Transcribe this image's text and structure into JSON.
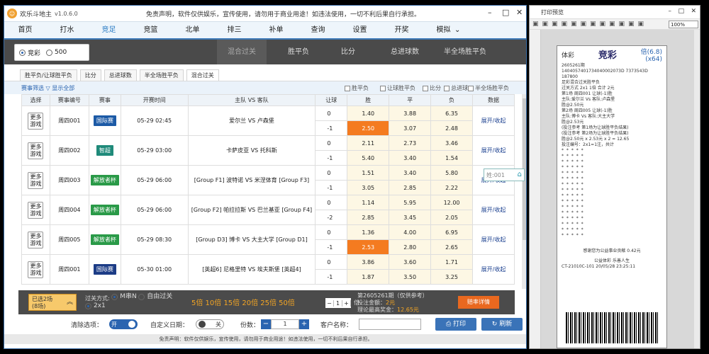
{
  "app": {
    "title": "欢乐斗地主",
    "version": "v1.0.6.0",
    "disclaimer": "免责声明，软件仅供娱乐，宣传使用，请勿用于商业用途！如违法使用，一切不利后果自行承担。"
  },
  "nav": [
    "首页",
    "打水",
    "竞足",
    "竞篮",
    "北单",
    "排三",
    "补单",
    "查询",
    "设置",
    "开奖",
    "模拟"
  ],
  "nav_active": "竞足",
  "lottery": {
    "options": [
      "竞彩",
      "500"
    ],
    "selected": "竞彩"
  },
  "play_tabs": [
    "混合过关",
    "胜平负",
    "比分",
    "总进球数",
    "半全场胜平负"
  ],
  "play_tab_active": "混合过关",
  "sub_tabs": [
    "胜平负/让球胜平负",
    "比分",
    "总进球数",
    "半全场胜平负",
    "混合过关"
  ],
  "sub_tab_active": "混合过关",
  "filter": {
    "left": "赛事筛选 ▽  显示全部",
    "checks": [
      "胜平负",
      "让球胜平负",
      "比分",
      "总进球",
      "半全场胜平负"
    ]
  },
  "table": {
    "headers": [
      "选择",
      "赛事编号",
      "赛事",
      "开赛时间",
      "主队 VS 客队",
      "让球",
      "胜",
      "平",
      "负",
      "数据"
    ],
    "more_label": "更多\n游戏",
    "expand_label": "展开/收起",
    "rows": [
      {
        "id": "周四001",
        "league": "国际赛",
        "league_color": "#1c5aa6",
        "time": "05-29 02:45",
        "teams": "爱尔兰 VS 卢森堡",
        "hcp": [
          "0",
          "-1"
        ],
        "odds": [
          [
            "1.40",
            "3.88",
            "6.35"
          ],
          [
            "2.50",
            "3.07",
            "2.48"
          ]
        ],
        "hl": [
          null,
          0
        ]
      },
      {
        "id": "周四002",
        "league": "智超",
        "league_color": "#1f8a7a",
        "time": "05-29 03:00",
        "teams": "卡萨皮亚 VS 托科斯",
        "hcp": [
          "0",
          "-1"
        ],
        "odds": [
          [
            "2.11",
            "2.73",
            "3.46"
          ],
          [
            "5.40",
            "3.40",
            "1.54"
          ]
        ],
        "hl": [
          null,
          null
        ]
      },
      {
        "id": "周四003",
        "league": "解放者杯",
        "league_color": "#2a9a48",
        "time": "05-29 06:00",
        "teams": "[Group F1] 波特诺 VS 米涅体育 [Group F3]",
        "hcp": [
          "0",
          "-1"
        ],
        "odds": [
          [
            "1.51",
            "3.40",
            "5.80"
          ],
          [
            "3.05",
            "2.85",
            "2.22"
          ]
        ],
        "hl": [
          null,
          null
        ]
      },
      {
        "id": "周四004",
        "league": "解放者杯",
        "league_color": "#2a9a48",
        "time": "05-29 06:00",
        "teams": "[Group F2] 帕拉拉斯 VS 巴兰基亚 [Group F4]",
        "hcp": [
          "0",
          "-2"
        ],
        "odds": [
          [
            "1.14",
            "5.95",
            "12.00"
          ],
          [
            "2.85",
            "3.45",
            "2.05"
          ]
        ],
        "hl": [
          null,
          null
        ]
      },
      {
        "id": "周四005",
        "league": "解放者杯",
        "league_color": "#2a9a48",
        "time": "05-29 08:30",
        "teams": "[Group D3] 博卡 VS 大主大学 [Group D1]",
        "hcp": [
          "0",
          "-1"
        ],
        "odds": [
          [
            "1.36",
            "4.00",
            "6.95"
          ],
          [
            "2.53",
            "2.80",
            "2.65"
          ]
        ],
        "hl": [
          null,
          0
        ]
      },
      {
        "id": "周四001",
        "league": "国际赛",
        "league_color": "#1c3c86",
        "time": "05-30 01:00",
        "teams": "[英超6] 尼格里特 VS 埃夫斯堡 [英超4]",
        "hcp": [
          "0",
          "-1"
        ],
        "odds": [
          [
            "3.86",
            "3.60",
            "1.71"
          ],
          [
            "1.87",
            "3.50",
            "3.25"
          ]
        ],
        "hl": [
          null,
          null
        ]
      }
    ]
  },
  "popup_placeholder": "姓:001",
  "betbar": {
    "selected": "已选2场",
    "selected_sub": "(8场)",
    "pass_label": "过关方式:",
    "pass_opts": [
      "M串N",
      "自由过关"
    ],
    "pass_sel": "2x1",
    "multipliers": "5倍 10倍 15倍 20倍 25倍 50倍",
    "mult_val": "1",
    "mult_suffix": "倍",
    "info_line1": "第2605261期（仅供参考）",
    "info_line2_label": "投注金额：",
    "info_line2_val": "2元",
    "info_line3_label": "理论最高奖金：",
    "info_line3_val": "12.65元",
    "detail_btn": "赔率详情"
  },
  "footer": {
    "clear_label": "清除选项：",
    "clear_toggle": "开",
    "date_label": "自定义日期：",
    "date_toggle": "关",
    "qty_label": "份数：",
    "qty_val": "1",
    "cust_label": "客户名称：",
    "print_btn": "打印",
    "refresh_btn": "刷新"
  },
  "bottom_note": "免责声明：软件仅供娱乐，宣传使用，请勿用于商业用途！如违法使用，一切不利后果自行承担。",
  "preview": {
    "title": "打印预览",
    "zoom": "100%",
    "brand": "体彩",
    "brand_logo": "竞彩",
    "mult": "倍(6.8)",
    "mult2": "(x64)",
    "line1": "2605261期",
    "line2": "1404057401734040002073D 7373543D 187800",
    "line3": "足彩混合过关胜平负",
    "line4": "过关方式 2x1          1倍         合计 2元",
    "line5": "第1场  周四001    让球(-1)胜",
    "line6": "主队:爱尔兰 Vs 客队:卢森堡",
    "line7": "胜@2.50元",
    "line8": "第2场  周四005    让球(-1)胜",
    "line9": "主队:博卡 Vs 客队:大主大学",
    "line10": "胜@2.53元",
    "line11": "(投注参考 第1场为让球胜平负结果)",
    "line12": "(投注参考 第2场为让球胜平负结果)",
    "line13": "胜@2.50元 x 2.53元 x 2 = 12.65",
    "line14": "投注编号：2x1=1注，共计",
    "footer1": "感谢您为公益事业贡献  0.42元",
    "footer2": "公益体彩  乐善人生",
    "footer3": "CT-21010C-101        20/05/28 23:25:11"
  }
}
